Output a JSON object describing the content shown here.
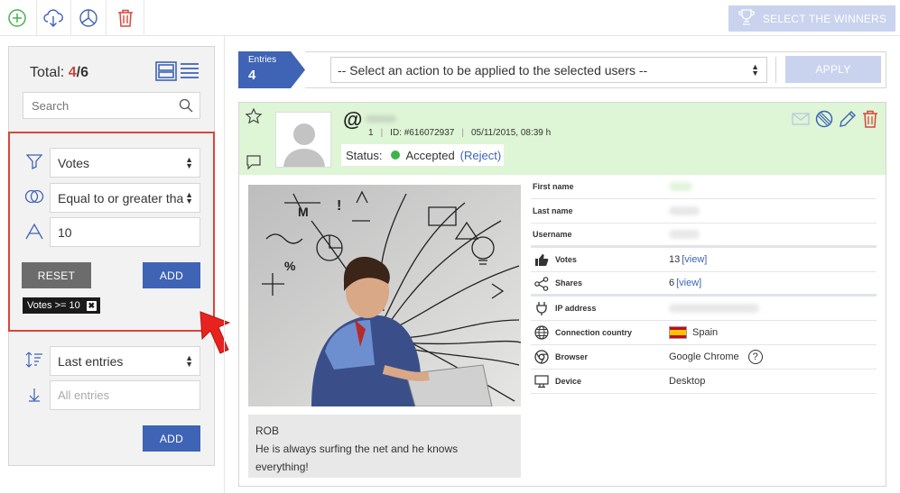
{
  "toolbar": {
    "icons": [
      "add-icon",
      "cloud-download-icon",
      "pie-chart-icon",
      "trash-icon"
    ],
    "winners_label": "SELECT THE WINNERS"
  },
  "sidebar": {
    "total_label": "Total:",
    "total_current": "4",
    "total_sep": "/",
    "total_all": "6",
    "search_placeholder": "Search",
    "filter": {
      "field": "Votes",
      "operator": "Equal to or greater than",
      "value": "10",
      "reset_label": "RESET",
      "add_label": "ADD",
      "tag_label": "Votes >= 10",
      "tag_remove": "✖"
    },
    "sort": {
      "field": "Last entries",
      "secondary_placeholder": "All entries",
      "add_label": "ADD"
    }
  },
  "actions": {
    "entries_label": "Entries",
    "entries_count": "4",
    "select_value": "-- Select an action to be applied to the selected users --",
    "apply_label": "APPLY"
  },
  "entry": {
    "at_sign": "@",
    "rank": "1",
    "id_text": "ID: #616072937",
    "date_text": "05/11/2015, 08:39 h",
    "status_label": "Status:",
    "status_value": "Accepted",
    "reject_label": "(Reject)",
    "caption_name": "ROB",
    "caption_text": "He is always surfing the net and he knows everything!",
    "details": {
      "first_name_label": "First name",
      "last_name_label": "Last name",
      "username_label": "Username",
      "votes_label": "Votes",
      "votes_value": "13",
      "view_label": "[view]",
      "shares_label": "Shares",
      "shares_value": "6",
      "ip_label": "IP address",
      "country_label": "Connection country",
      "country_value": "Spain",
      "browser_label": "Browser",
      "browser_value": "Google Chrome",
      "help_label": "?",
      "device_label": "Device",
      "device_value": "Desktop"
    }
  },
  "colors": {
    "accent_blue": "#3f63b5",
    "accepted_green": "#3cb44a",
    "highlight_red": "#d9463b",
    "header_green": "#def5d6"
  }
}
